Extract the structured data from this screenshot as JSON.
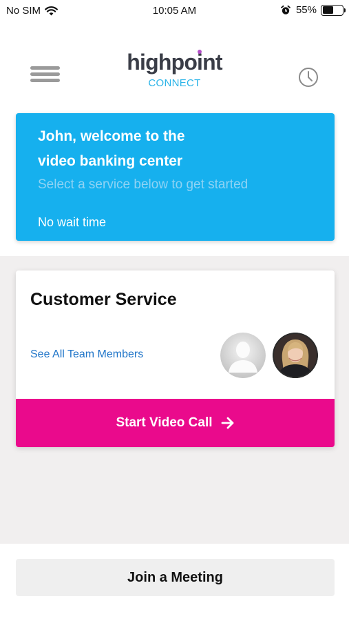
{
  "status_bar": {
    "carrier": "No SIM",
    "time": "10:05 AM",
    "battery_percent_label": "55%",
    "battery_level": 0.55
  },
  "header": {
    "logo_name": "highpoint",
    "logo_sub": "CONNECT",
    "menu_icon": "hamburger-menu-icon",
    "history_icon": "clock-icon"
  },
  "welcome": {
    "line1": "John, welcome to the",
    "line2": "video banking center",
    "subtitle": "Select a service below to get started",
    "wait": "No wait time"
  },
  "service": {
    "title": "Customer Service",
    "team_link": "See All Team Members",
    "call_label": "Start Video Call"
  },
  "join": {
    "label": "Join a Meeting"
  },
  "colors": {
    "banner": "#16b0ee",
    "call_button": "#ea0a8c",
    "link": "#1e74c8",
    "logo_sub": "#2ab4e8"
  }
}
